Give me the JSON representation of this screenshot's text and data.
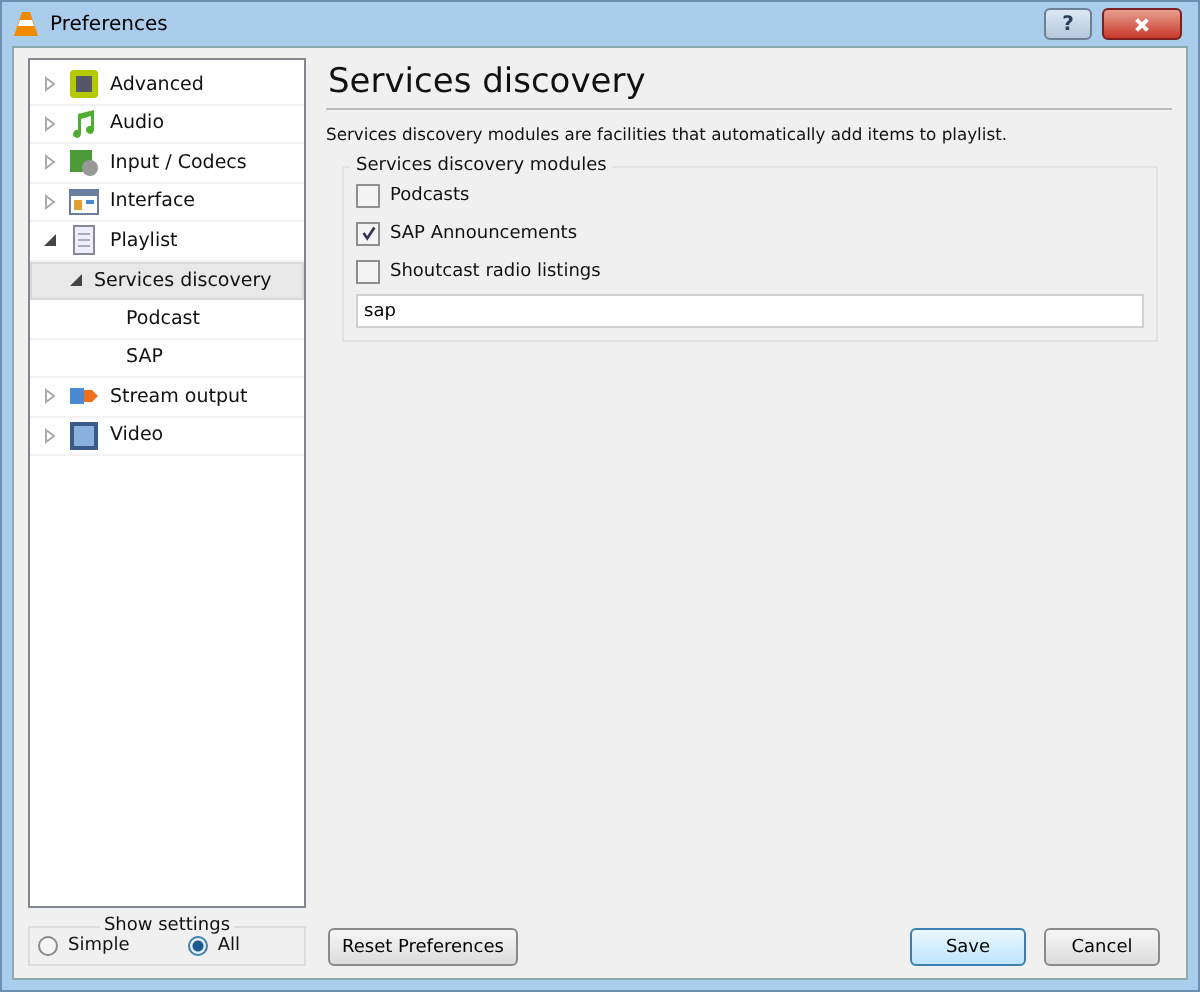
{
  "window": {
    "title": "Preferences",
    "help_button": "?"
  },
  "tree": [
    {
      "label": "Advanced",
      "expanded": false,
      "selected": false
    },
    {
      "label": "Audio",
      "expanded": false,
      "selected": false
    },
    {
      "label": "Input / Codecs",
      "expanded": false,
      "selected": false
    },
    {
      "label": "Interface",
      "expanded": false,
      "selected": false
    },
    {
      "label": "Playlist",
      "expanded": true,
      "selected": false,
      "children": [
        {
          "label": "Services discovery",
          "expanded": true,
          "selected": true,
          "children": [
            {
              "label": "Podcast",
              "selected": false
            },
            {
              "label": "SAP",
              "selected": false
            }
          ]
        }
      ]
    },
    {
      "label": "Stream output",
      "expanded": false,
      "selected": false
    },
    {
      "label": "Video",
      "expanded": false,
      "selected": false
    }
  ],
  "show_settings": {
    "title": "Show settings",
    "options": [
      {
        "label": "Simple",
        "selected": false
      },
      {
        "label": "All",
        "selected": true
      }
    ]
  },
  "panel": {
    "heading": "Services discovery",
    "description": "Services discovery modules are facilities that automatically add items to playlist.",
    "group_title": "Services discovery modules",
    "modules": [
      {
        "label": "Podcasts",
        "checked": false
      },
      {
        "label": "SAP Announcements",
        "checked": true
      },
      {
        "label": "Shoutcast radio listings",
        "checked": false
      }
    ],
    "modules_value": "sap"
  },
  "buttons": {
    "reset": "Reset Preferences",
    "save": "Save",
    "cancel": "Cancel"
  }
}
